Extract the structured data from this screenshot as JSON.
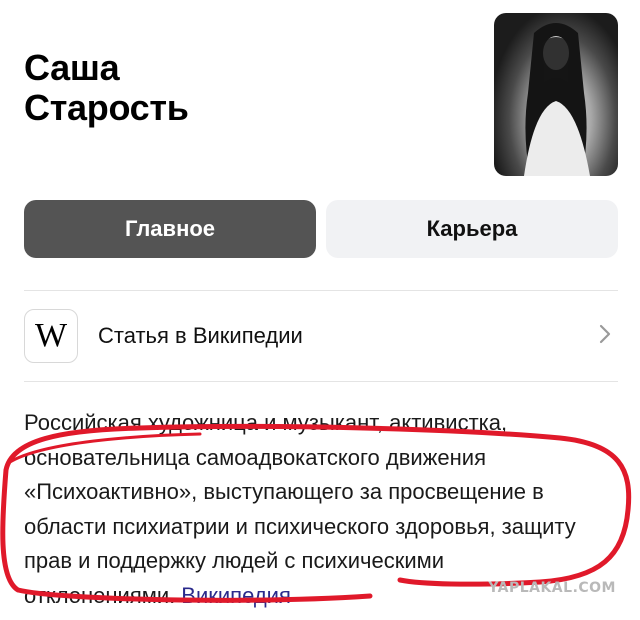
{
  "header": {
    "title_line1": "Саша",
    "title_line2": "Старость"
  },
  "tabs": [
    {
      "label": "Главное",
      "active": true
    },
    {
      "label": "Карьера",
      "active": false
    }
  ],
  "wikipedia": {
    "logo": "W",
    "label": "Статья в Википедии",
    "icon": "chevron-right-icon"
  },
  "description": {
    "text": "Российская художница и музыкант, активистка, основательница самоадвокатского движения «Психоактивно», выступающего за просвещение в области психиатрии и психического здоровья, защиту прав и поддержку людей с психическими отклонениями.",
    "source": "Википедия"
  },
  "watermark": "YAPLAKAL.COM",
  "colors": {
    "active_tab": "#545454",
    "inactive_tab": "#f1f2f4",
    "link": "#2a2a8c",
    "annotation": "#e0192a"
  }
}
